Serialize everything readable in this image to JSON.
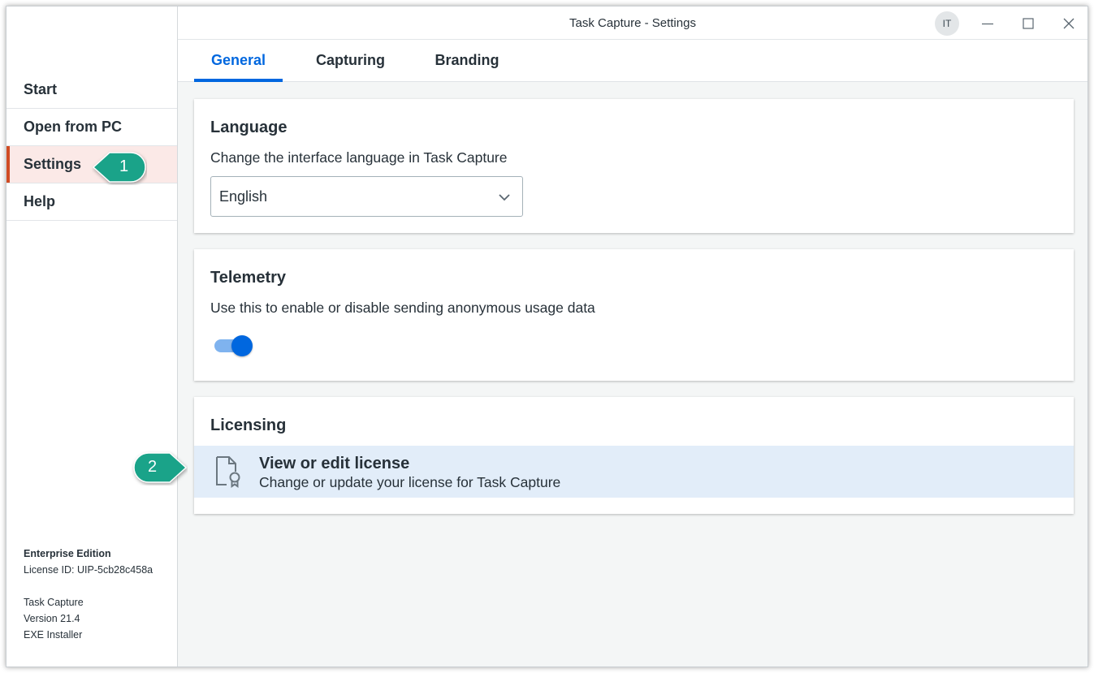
{
  "window": {
    "title": "Task Capture - Settings",
    "user_initials": "IT"
  },
  "sidebar": {
    "items": [
      {
        "label": "Start"
      },
      {
        "label": "Open from PC"
      },
      {
        "label": "Settings",
        "active": true
      },
      {
        "label": "Help"
      }
    ],
    "edition": "Enterprise Edition",
    "license_id": "License ID: UIP-5cb28c458a",
    "product_name": "Task Capture",
    "version": "Version 21.4",
    "installer": "EXE Installer"
  },
  "tabs": [
    {
      "label": "General",
      "active": true
    },
    {
      "label": "Capturing"
    },
    {
      "label": "Branding"
    }
  ],
  "language": {
    "title": "Language",
    "description": "Change the interface language in Task Capture",
    "selected": "English"
  },
  "telemetry": {
    "title": "Telemetry",
    "description": "Use this to enable or disable sending anonymous usage data",
    "enabled": true
  },
  "licensing": {
    "title": "Licensing",
    "item_label": "View or edit license",
    "item_description": "Change or update your license for Task Capture"
  },
  "callouts": [
    {
      "number": "1"
    },
    {
      "number": "2"
    }
  ],
  "colors": {
    "accent": "#0067df",
    "active_nav_bar": "#d04b23",
    "callout": "#1aa389"
  }
}
